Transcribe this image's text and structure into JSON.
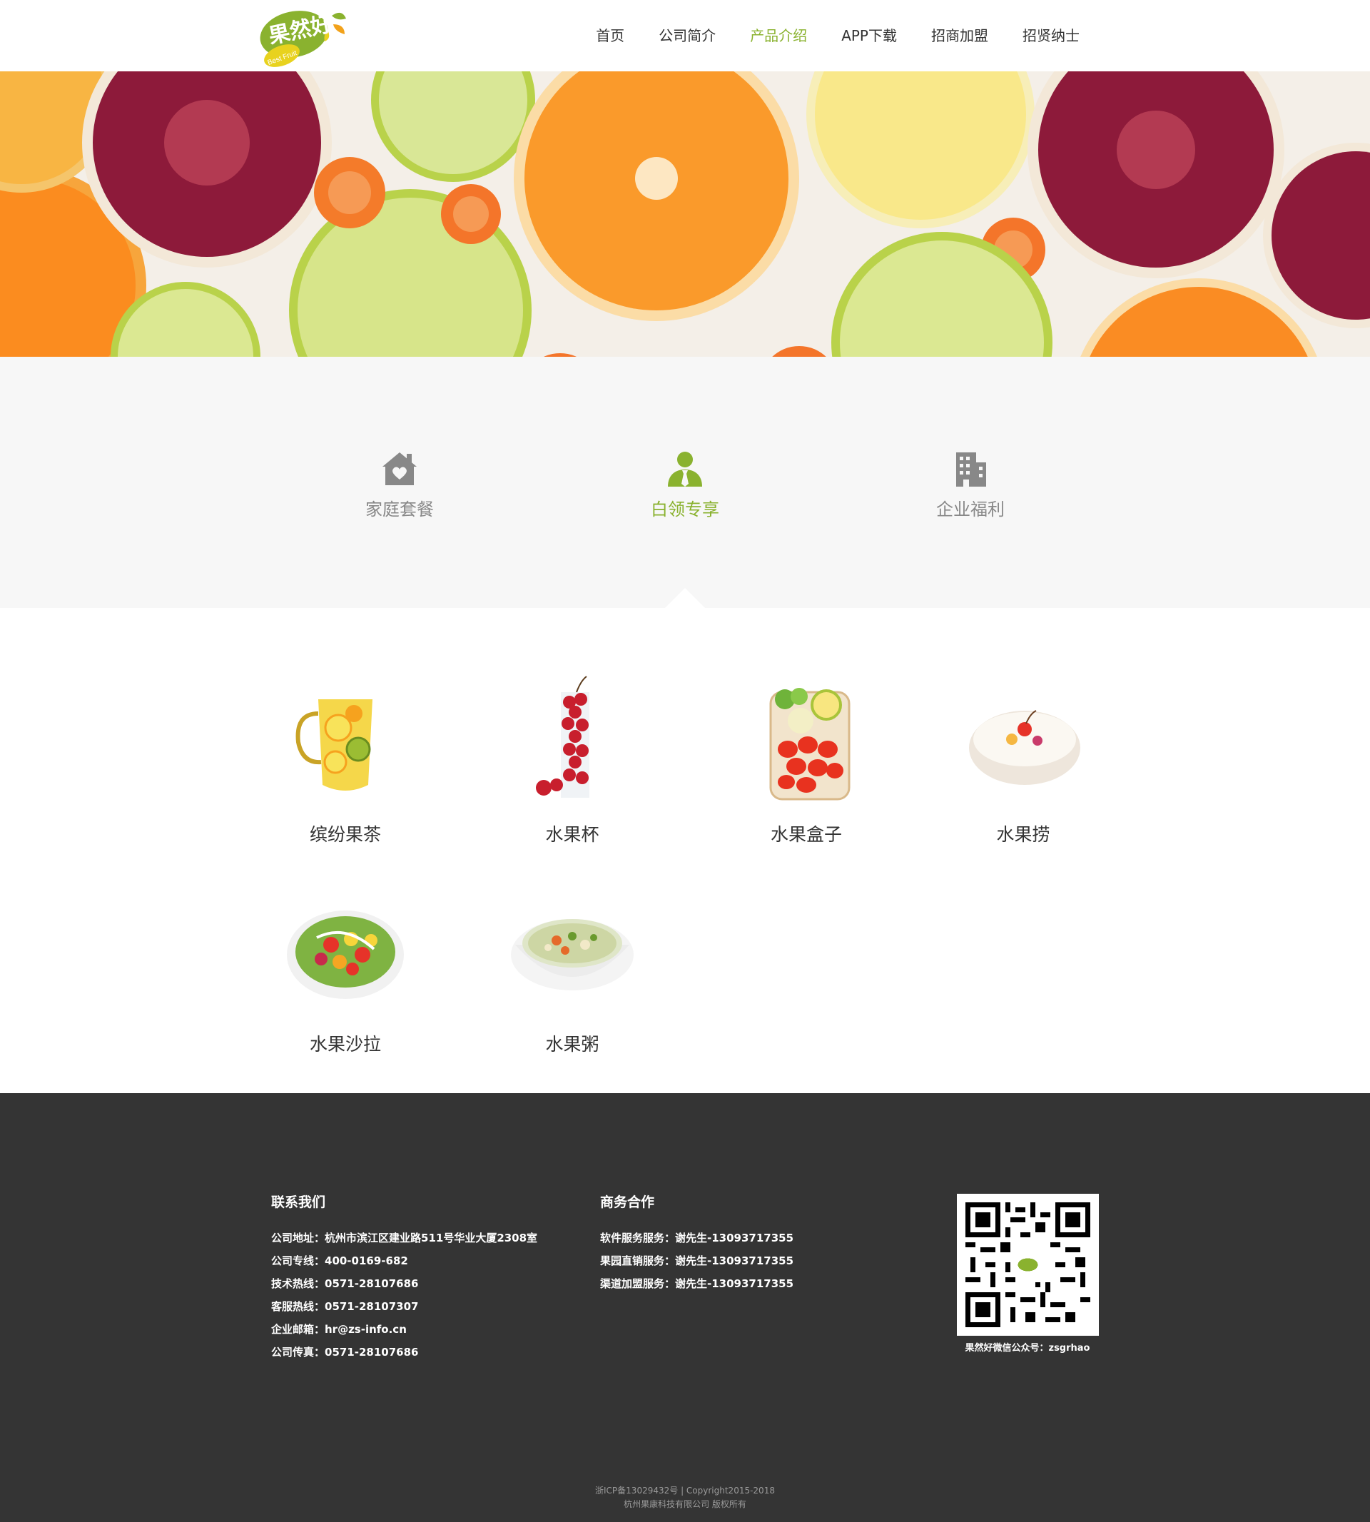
{
  "header": {
    "logo_text": "果然好",
    "logo_sub": "Best Fruit",
    "nav": [
      {
        "label": "首页",
        "active": false
      },
      {
        "label": "公司简介",
        "active": false
      },
      {
        "label": "产品介绍",
        "active": true
      },
      {
        "label": "APP下载",
        "active": false
      },
      {
        "label": "招商加盟",
        "active": false
      },
      {
        "label": "招贤纳士",
        "active": false
      }
    ]
  },
  "tabs": [
    {
      "label": "家庭套餐",
      "icon": "house-heart-icon",
      "active": false
    },
    {
      "label": "白领专享",
      "icon": "person-tie-icon",
      "active": true
    },
    {
      "label": "企业福利",
      "icon": "building-icon",
      "active": false
    }
  ],
  "products": [
    {
      "name": "缤纷果茶",
      "icon": "fruit-tea-pitcher-image"
    },
    {
      "name": "水果杯",
      "icon": "fruit-cup-image"
    },
    {
      "name": "水果盒子",
      "icon": "fruit-box-image"
    },
    {
      "name": "水果捞",
      "icon": "fruit-lao-bowl-image"
    },
    {
      "name": "水果沙拉",
      "icon": "fruit-salad-image"
    },
    {
      "name": "水果粥",
      "icon": "fruit-porridge-image"
    }
  ],
  "footer": {
    "contact": {
      "title": "联系我们",
      "lines": [
        "公司地址：杭州市滨江区建业路511号华业大厦2308室",
        "公司专线：400-0169-682",
        "技术热线：0571-28107686",
        "客服热线：0571-28107307",
        "企业邮箱：hr@zs-info.cn",
        "公司传真：0571-28107686"
      ]
    },
    "business": {
      "title": "商务合作",
      "lines": [
        "软件服务服务：谢先生-13093717355",
        "果园直销服务：谢先生-13093717355",
        "渠道加盟服务：谢先生-13093717355"
      ]
    },
    "qr_caption": "果然好微信公众号：zsgrhao",
    "icp": "浙ICP备13029432号  |  Copyright2015-2018",
    "company": "杭州果康科技有限公司 版权所有"
  },
  "colors": {
    "accent": "#8ab22f",
    "footer_bg": "#343434",
    "tabs_bg": "#f7f7f7"
  }
}
